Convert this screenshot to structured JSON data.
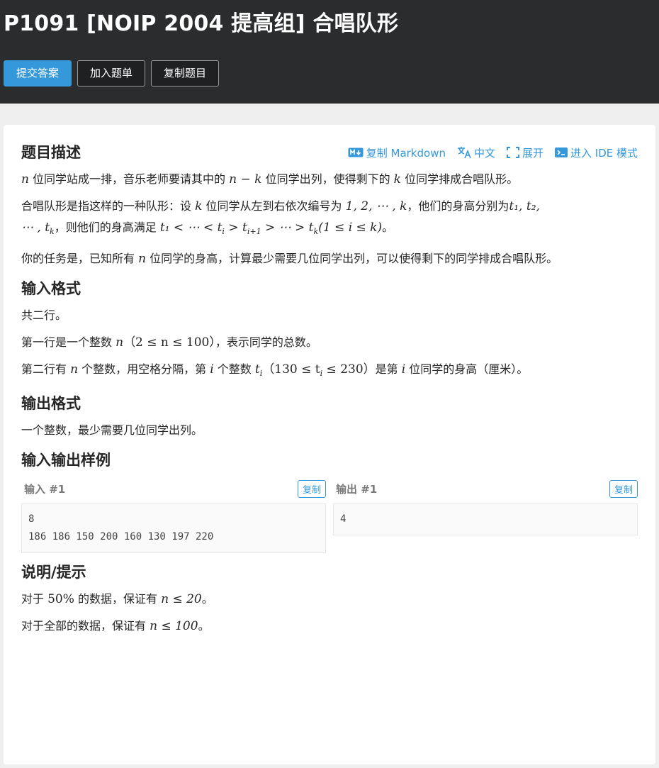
{
  "header": {
    "title": "P1091 [NOIP 2004 提高组] 合唱队形",
    "buttons": {
      "submit": "提交答案",
      "add_list": "加入题单",
      "copy_problem": "复制题目"
    }
  },
  "tools": {
    "copy_md": "复制 Markdown",
    "lang": "中文",
    "expand": "展开",
    "ide": "进入 IDE 模式"
  },
  "sections": {
    "desc_title": "题目描述",
    "input_title": "输入格式",
    "output_title": "输出格式",
    "samples_title": "输入输出样例",
    "hint_title": "说明/提示"
  },
  "text": {
    "d1a": "位同学站成一排，音乐老师要请其中的",
    "d1b": "位同学出列，使得剩下的",
    "d1c": "位同学排成合唱队形。",
    "d2a": "合唱队形是指这样的一种队形：设",
    "d2b": "位同学从左到右依次编号为",
    "d2c": "，他们的身高分别为",
    "d2d": "，则他们的身高满足",
    "d3a": "你的任务是，已知所有",
    "d3b": "位同学的身高，计算最少需要几位同学出列，可以使得剩下的同学排成合唱队形。",
    "in1": "共二行。",
    "in2a": "第一行是一个整数",
    "in2b": "，表示同学的总数。",
    "in3a": "第二行有",
    "in3b": "个整数，用空格分隔，第",
    "in3c": "个整数",
    "in3d": "是第",
    "in3e": "位同学的身高（厘米）。",
    "out1": "一个整数，最少需要几位同学出列。",
    "h1a": "对于",
    "h1b": "的数据，保证有",
    "h2a": "对于全部的数据，保证有"
  },
  "math": {
    "n": "n",
    "k": "k",
    "nk": "n − k",
    "i": "i",
    "seq": "1, 2, ⋯ , k",
    "ts": "t₁, t₂,",
    "ts2": "⋯ , t",
    "cond1": "t₁ < ⋯ < t",
    "cond2": " > t",
    "cond3": " > ⋯ > t",
    "cond4": "(1 ≤ i ≤ k)",
    "nrange": "（2 ≤ n ≤ 100）",
    "trange": "（130 ≤ t",
    "trange2": " ≤ 230）",
    "pct": "50%",
    "h1cond": "n ≤ 20",
    "h2cond": "n ≤ 100",
    "sub_k": "k",
    "sub_i": "i",
    "sub_i1": "i+1"
  },
  "samples": {
    "input_label": "输入 #1",
    "output_label": "输出 #1",
    "copy": "复制",
    "input": "8\n186 186 150 200 160 130 197 220",
    "output": "4"
  }
}
